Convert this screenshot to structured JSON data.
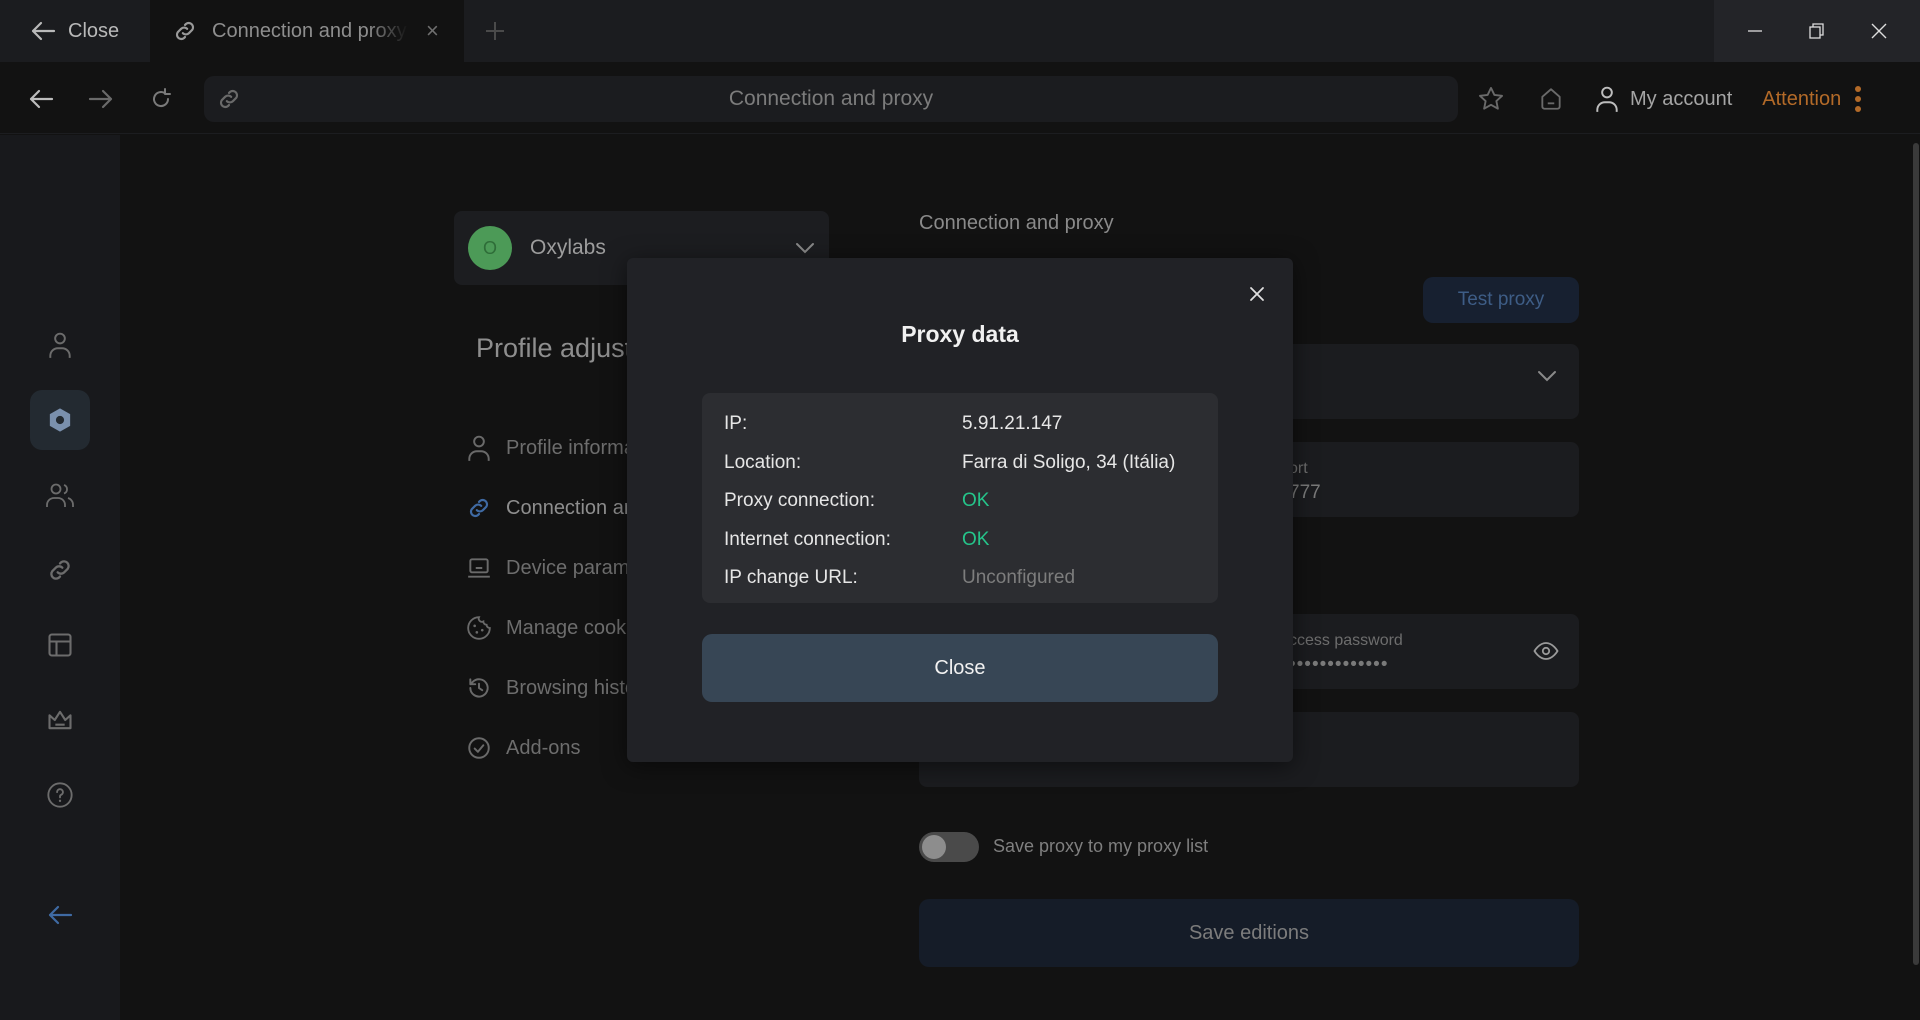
{
  "titlebar": {
    "close_label": "Close",
    "tab_label": "Connection and proxy"
  },
  "navbar": {
    "address": "Connection and proxy",
    "my_account": "My account",
    "attention": "Attention"
  },
  "rail": {
    "items": [
      "profile",
      "settings",
      "users",
      "links",
      "templates",
      "premium",
      "help",
      "collapse"
    ],
    "active": "settings"
  },
  "profile": {
    "avatar_letter": "O",
    "name": "Oxylabs"
  },
  "page": {
    "title": "Profile adjustments",
    "menu": [
      {
        "label": "Profile information",
        "icon": "user-icon"
      },
      {
        "label": "Connection and proxy",
        "icon": "link-icon",
        "active": true
      },
      {
        "label": "Device parameters",
        "icon": "laptop-icon"
      },
      {
        "label": "Manage cookies",
        "icon": "cookie-icon"
      },
      {
        "label": "Browsing history",
        "icon": "history-icon"
      },
      {
        "label": "Add-ons",
        "icon": "check-circle-icon"
      }
    ]
  },
  "form": {
    "section_title": "Connection and proxy",
    "test_proxy": "Test proxy",
    "port_label": "ort",
    "port_value": "777",
    "password_label": "ccess password",
    "password_value": "•••••••••••••",
    "save_toggle_label": "Save proxy to my proxy list",
    "save_toggle_on": false,
    "save_button": "Save editions"
  },
  "modal": {
    "title": "Proxy data",
    "rows": [
      {
        "key": "IP:",
        "value": "5.91.21.147",
        "status": "normal"
      },
      {
        "key": "Location:",
        "value": "Farra di Soligo, 34 (Itália)",
        "status": "normal"
      },
      {
        "key": "Proxy connection:",
        "value": "OK",
        "status": "ok"
      },
      {
        "key": "Internet connection:",
        "value": "OK",
        "status": "ok"
      },
      {
        "key": "IP change URL:",
        "value": "Unconfigured",
        "status": "muted"
      }
    ],
    "close_button": "Close"
  },
  "colors": {
    "accent_ok": "#25c48a",
    "attention": "#b36a28",
    "primary_button": "#374655"
  }
}
